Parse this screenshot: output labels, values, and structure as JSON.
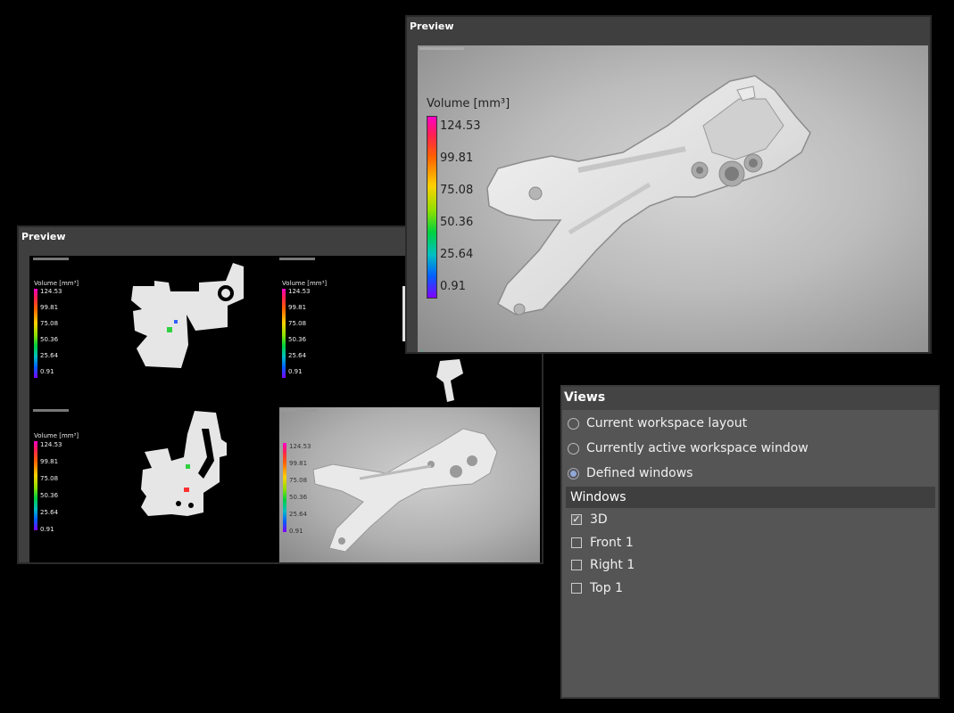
{
  "small_preview": {
    "title": "Preview",
    "legend": {
      "title": "Volume [mm³]",
      "ticks": [
        "124.53",
        "99.81",
        "75.08",
        "50.36",
        "25.64",
        "0.91"
      ]
    }
  },
  "big_preview": {
    "title": "Preview",
    "legend": {
      "title": "Volume [mm³]",
      "ticks": [
        "124.53",
        "99.81",
        "75.08",
        "50.36",
        "25.64",
        "0.91"
      ]
    }
  },
  "views": {
    "title": "Views",
    "options": [
      {
        "label": "Current workspace layout",
        "selected": false
      },
      {
        "label": "Currently active workspace window",
        "selected": false
      },
      {
        "label": "Defined windows",
        "selected": true
      }
    ],
    "windows_header": "Windows",
    "windows": [
      {
        "label": "3D",
        "checked": true
      },
      {
        "label": "Front 1",
        "checked": false
      },
      {
        "label": "Right 1",
        "checked": false
      },
      {
        "label": "Top 1",
        "checked": false
      }
    ]
  },
  "colors": {
    "panel_bg": "#3f3f3f",
    "views_bg": "#555555",
    "radio_accent": "#8fa8d8"
  }
}
